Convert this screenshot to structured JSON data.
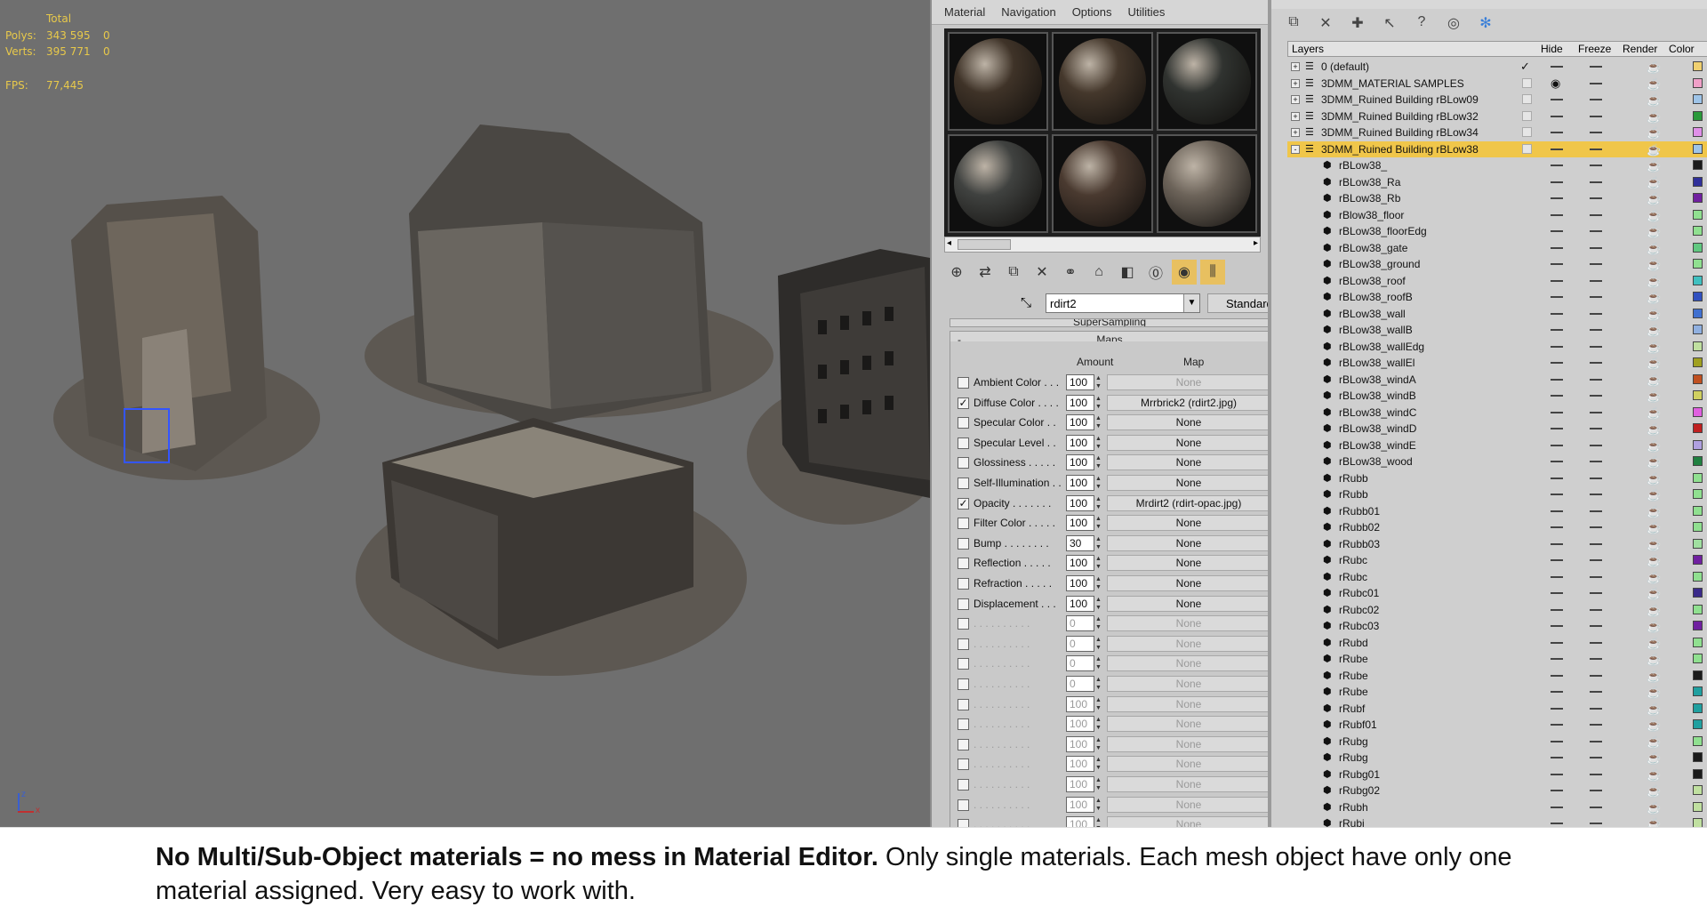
{
  "viewport": {
    "stats": {
      "header": "Total",
      "polys_label": "Polys:",
      "polys_total": "343 595",
      "polys_sel": "0",
      "verts_label": "Verts:",
      "verts_total": "395 771",
      "verts_sel": "0",
      "fps_label": "FPS:",
      "fps_value": "77,445"
    },
    "axis": {
      "z": "z",
      "x": "x"
    }
  },
  "material_editor": {
    "menu": [
      "Material",
      "Navigation",
      "Options",
      "Utilities"
    ],
    "sample_colors": [
      "#3f3328",
      "#45382c",
      "#303330",
      "#404240",
      "#4a3a30",
      "#6d645a"
    ],
    "material_name": "rdirt2",
    "type_button": "Standard",
    "supersampling_label": "SuperSampling",
    "maps_label": "Maps",
    "amount_header": "Amount",
    "map_header": "Map",
    "rows": [
      {
        "checked": false,
        "label": "Ambient Color . . .",
        "amount": "100",
        "map": "None",
        "dim_map": true
      },
      {
        "checked": true,
        "label": "Diffuse Color . . . .",
        "amount": "100",
        "map": "Mrrbrick2 (rdirt2.jpg)",
        "dim_map": false
      },
      {
        "checked": false,
        "label": "Specular Color . .",
        "amount": "100",
        "map": "None",
        "dim_map": false
      },
      {
        "checked": false,
        "label": "Specular Level . .",
        "amount": "100",
        "map": "None",
        "dim_map": false
      },
      {
        "checked": false,
        "label": "Glossiness . . . . .",
        "amount": "100",
        "map": "None",
        "dim_map": false
      },
      {
        "checked": false,
        "label": "Self-Illumination . .",
        "amount": "100",
        "map": "None",
        "dim_map": false
      },
      {
        "checked": true,
        "label": "Opacity . . . . . . .",
        "amount": "100",
        "map": "Mrdirt2 (rdirt-opac.jpg)",
        "dim_map": false
      },
      {
        "checked": false,
        "label": "Filter Color . . . . .",
        "amount": "100",
        "map": "None",
        "dim_map": false
      },
      {
        "checked": false,
        "label": "Bump . . . . . . . .",
        "amount": "30",
        "map": "None",
        "dim_map": false
      },
      {
        "checked": false,
        "label": "Reflection . . . . .",
        "amount": "100",
        "map": "None",
        "dim_map": false
      },
      {
        "checked": false,
        "label": "Refraction . . . . .",
        "amount": "100",
        "map": "None",
        "dim_map": false
      },
      {
        "checked": false,
        "label": "Displacement . . .",
        "amount": "100",
        "map": "None",
        "dim_map": false
      },
      {
        "checked": false,
        "label": ". . . . . . . . . .",
        "amount": "0",
        "map": "None",
        "dim_map": true
      },
      {
        "checked": false,
        "label": ". . . . . . . . . .",
        "amount": "0",
        "map": "None",
        "dim_map": true
      },
      {
        "checked": false,
        "label": ". . . . . . . . . .",
        "amount": "0",
        "map": "None",
        "dim_map": true
      },
      {
        "checked": false,
        "label": ". . . . . . . . . .",
        "amount": "0",
        "map": "None",
        "dim_map": true
      },
      {
        "checked": false,
        "label": ". . . . . . . . . .",
        "amount": "100",
        "map": "None",
        "dim_map": true
      },
      {
        "checked": false,
        "label": ". . . . . . . . . .",
        "amount": "100",
        "map": "None",
        "dim_map": true
      },
      {
        "checked": false,
        "label": ". . . . . . . . . .",
        "amount": "100",
        "map": "None",
        "dim_map": true
      },
      {
        "checked": false,
        "label": ". . . . . . . . . .",
        "amount": "100",
        "map": "None",
        "dim_map": true
      },
      {
        "checked": false,
        "label": ". . . . . . . . . .",
        "amount": "100",
        "map": "None",
        "dim_map": true
      },
      {
        "checked": false,
        "label": ". . . . . . . . . .",
        "amount": "100",
        "map": "None",
        "dim_map": true
      },
      {
        "checked": false,
        "label": ". . . . . . . . . .",
        "amount": "100",
        "map": "None",
        "dim_map": true
      }
    ]
  },
  "layer_manager": {
    "headers": {
      "layers": "Layers",
      "hide": "Hide",
      "freeze": "Freeze",
      "render": "Render",
      "color": "Color"
    },
    "layers": [
      {
        "name": "0 (default)",
        "kind": "layer",
        "expand": "+",
        "color": "#f0d070",
        "active": true
      },
      {
        "name": "3DMM_MATERIAL SAMPLES",
        "kind": "layer",
        "expand": "+",
        "color": "#f0a0c8",
        "hidden": true
      },
      {
        "name": "3DMM_Ruined Building rBLow09",
        "kind": "layer",
        "expand": "+",
        "color": "#9ec4e8"
      },
      {
        "name": "3DMM_Ruined Building rBLow32",
        "kind": "layer",
        "expand": "+",
        "color": "#2a9a3a"
      },
      {
        "name": "3DMM_Ruined Building rBLow34",
        "kind": "layer",
        "expand": "+",
        "color": "#e090e8"
      },
      {
        "name": "3DMM_Ruined Building rBLow38",
        "kind": "layer",
        "expand": "-",
        "color": "#9ec4e8",
        "selected": true
      },
      {
        "name": "rBLow38_",
        "kind": "object",
        "color": "#1a1a1a"
      },
      {
        "name": "rBLow38_Ra",
        "kind": "object",
        "color": "#30309a"
      },
      {
        "name": "rBLow38_Rb",
        "kind": "object",
        "color": "#7020a0"
      },
      {
        "name": "rBlow38_floor",
        "kind": "object",
        "color": "#90e090"
      },
      {
        "name": "rBLow38_floorEdg",
        "kind": "object",
        "color": "#90e090"
      },
      {
        "name": "rBLow38_gate",
        "kind": "object",
        "color": "#60c880"
      },
      {
        "name": "rBLow38_ground",
        "kind": "object",
        "color": "#90e090"
      },
      {
        "name": "rBLow38_roof",
        "kind": "object",
        "color": "#40c0c0"
      },
      {
        "name": "rBLow38_roofB",
        "kind": "object",
        "color": "#3050c0"
      },
      {
        "name": "rBLow38_wall",
        "kind": "object",
        "color": "#4070d0"
      },
      {
        "name": "rBLow38_wallB",
        "kind": "object",
        "color": "#90b0e0"
      },
      {
        "name": "rBLow38_wallEdg",
        "kind": "object",
        "color": "#c0e0a0"
      },
      {
        "name": "rBLow38_wallEl",
        "kind": "object",
        "color": "#a0a020"
      },
      {
        "name": "rBLow38_windA",
        "kind": "object",
        "color": "#c05020"
      },
      {
        "name": "rBLow38_windB",
        "kind": "object",
        "color": "#d0d060"
      },
      {
        "name": "rBLow38_windC",
        "kind": "object",
        "color": "#e060e0"
      },
      {
        "name": "rBLow38_windD",
        "kind": "object",
        "color": "#c02020"
      },
      {
        "name": "rBLow38_windE",
        "kind": "object",
        "color": "#b0a0e0"
      },
      {
        "name": "rBLow38_wood",
        "kind": "object",
        "color": "#208040"
      },
      {
        "name": "rRubb",
        "kind": "object",
        "color": "#90e090"
      },
      {
        "name": "rRubb",
        "kind": "object",
        "color": "#90e090"
      },
      {
        "name": "rRubb01",
        "kind": "object",
        "color": "#90e090"
      },
      {
        "name": "rRubb02",
        "kind": "object",
        "color": "#90e090"
      },
      {
        "name": "rRubb03",
        "kind": "object",
        "color": "#a0e0a0"
      },
      {
        "name": "rRubc",
        "kind": "object",
        "color": "#7020a0"
      },
      {
        "name": "rRubc",
        "kind": "object",
        "color": "#90e090"
      },
      {
        "name": "rRubc01",
        "kind": "object",
        "color": "#3a2a8a"
      },
      {
        "name": "rRubc02",
        "kind": "object",
        "color": "#90e090"
      },
      {
        "name": "rRubc03",
        "kind": "object",
        "color": "#7020a0"
      },
      {
        "name": "rRubd",
        "kind": "object",
        "color": "#90e090"
      },
      {
        "name": "rRube",
        "kind": "object",
        "color": "#90e090"
      },
      {
        "name": "rRube",
        "kind": "object",
        "color": "#1a1a1a"
      },
      {
        "name": "rRube",
        "kind": "object",
        "color": "#20a0a0"
      },
      {
        "name": "rRubf",
        "kind": "object",
        "color": "#20a0a0"
      },
      {
        "name": "rRubf01",
        "kind": "object",
        "color": "#20a0a0"
      },
      {
        "name": "rRubg",
        "kind": "object",
        "color": "#90e090"
      },
      {
        "name": "rRubg",
        "kind": "object",
        "color": "#1a1a1a"
      },
      {
        "name": "rRubg01",
        "kind": "object",
        "color": "#1a1a1a"
      },
      {
        "name": "rRubg02",
        "kind": "object",
        "color": "#c0e0a0"
      },
      {
        "name": "rRubh",
        "kind": "object",
        "color": "#c0e0a0"
      },
      {
        "name": "rRubi",
        "kind": "object",
        "color": "#c0e0a0"
      }
    ]
  },
  "caption": {
    "bold": "No Multi/Sub-Object materials = no mess in Material Editor.",
    "text": " Only single materials. Each mesh object have only one material assigned. Very easy to work with."
  }
}
